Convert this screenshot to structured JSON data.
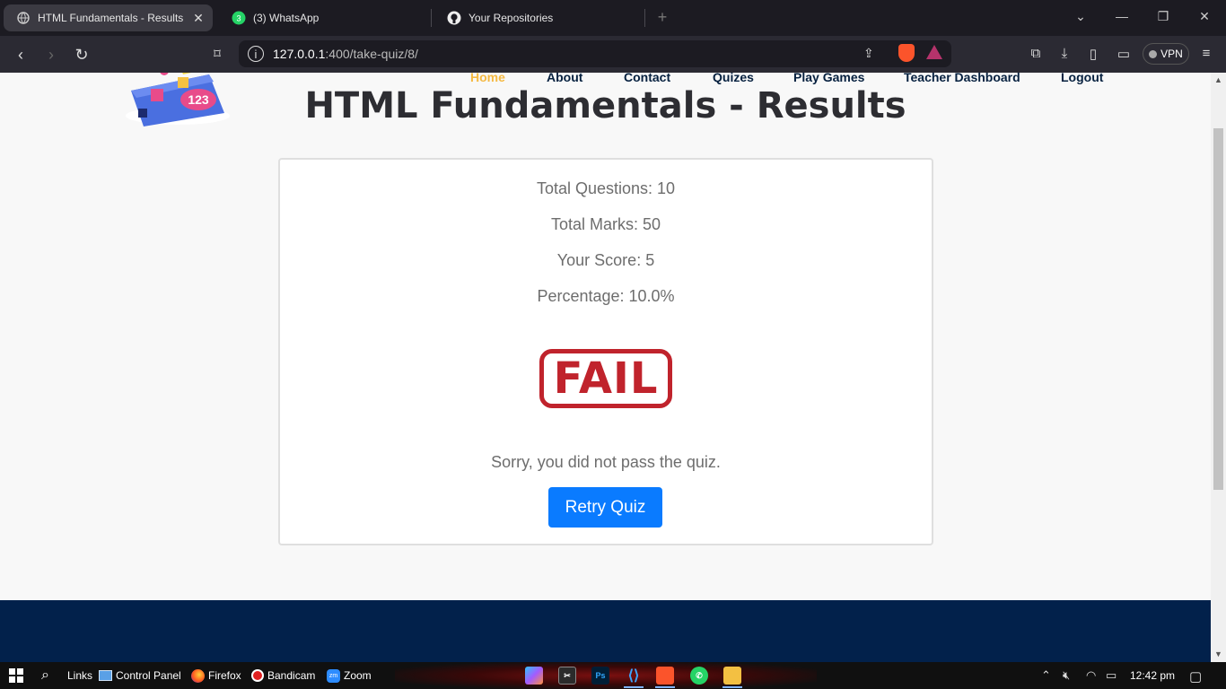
{
  "browser": {
    "tabs": [
      {
        "label": "HTML Fundamentals - Results",
        "icon": "globe-icon",
        "active": true
      },
      {
        "label": "(3) WhatsApp",
        "icon": "whatsapp-icon",
        "badge": "3",
        "active": false
      },
      {
        "label": "Your Repositories",
        "icon": "github-icon",
        "active": false
      }
    ],
    "url_host": "127.0.0.1",
    "url_path": ":400/take-quiz/8/",
    "vpn_label": "VPN"
  },
  "nav": {
    "items": [
      "Home",
      "About",
      "Contact",
      "Quizes",
      "Play Games",
      "Teacher Dashboard",
      "Logout"
    ],
    "active": "Home"
  },
  "logo": {
    "text": "123"
  },
  "page": {
    "title": "HTML Fundamentals - Results"
  },
  "results": {
    "total_questions": "Total Questions: 10",
    "total_marks": "Total Marks: 50",
    "score": "Your Score: 5",
    "percentage": "Percentage: 10.0%",
    "stamp": "FAIL",
    "message": "Sorry, you did not pass the quiz.",
    "retry_label": "Retry Quiz"
  },
  "colors": {
    "accent": "#0a7bff",
    "fail": "#c0232c",
    "nav_active": "#f5b942",
    "footer": "#02214b"
  },
  "taskbar": {
    "links_label": "Links",
    "control_panel_label": "Control Panel",
    "firefox_label": "Firefox",
    "bandicam_label": "Bandicam",
    "zoom_label": "Zoom",
    "zoom_icon_text": "zm",
    "ps_icon_text": "Ps",
    "time": "12:42 pm"
  }
}
